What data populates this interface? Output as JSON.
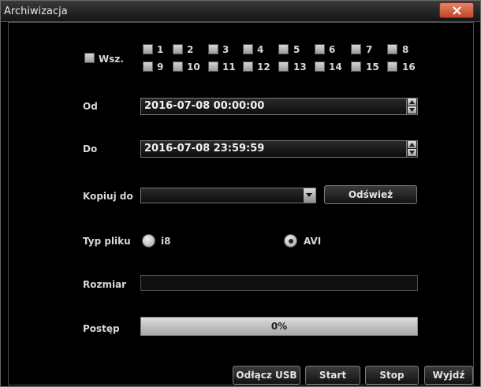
{
  "window": {
    "title": "Archiwizacja"
  },
  "channels": {
    "all_label": "Wsz.",
    "items": [
      "1",
      "2",
      "3",
      "4",
      "5",
      "6",
      "7",
      "8",
      "9",
      "10",
      "11",
      "12",
      "13",
      "14",
      "15",
      "16"
    ]
  },
  "from": {
    "label": "Od",
    "value": "2016-07-08 00:00:00"
  },
  "to": {
    "label": "Do",
    "value": "2016-07-08 23:59:59"
  },
  "copy_to": {
    "label": "Kopiuj do",
    "value": "",
    "refresh_label": "Odśwież"
  },
  "file_type": {
    "label": "Typ pliku",
    "options": [
      "i8",
      "AVI"
    ],
    "selected": "AVI"
  },
  "size": {
    "label": "Rozmiar",
    "value": ""
  },
  "progress": {
    "label": "Postęp",
    "percent": 0,
    "text": "0%"
  },
  "buttons": {
    "disconnect_usb": "Odłącz USB",
    "start": "Start",
    "stop": "Stop",
    "exit": "Wyjdź"
  },
  "colors": {
    "close_button": "#d0583a",
    "background": "#000000"
  }
}
